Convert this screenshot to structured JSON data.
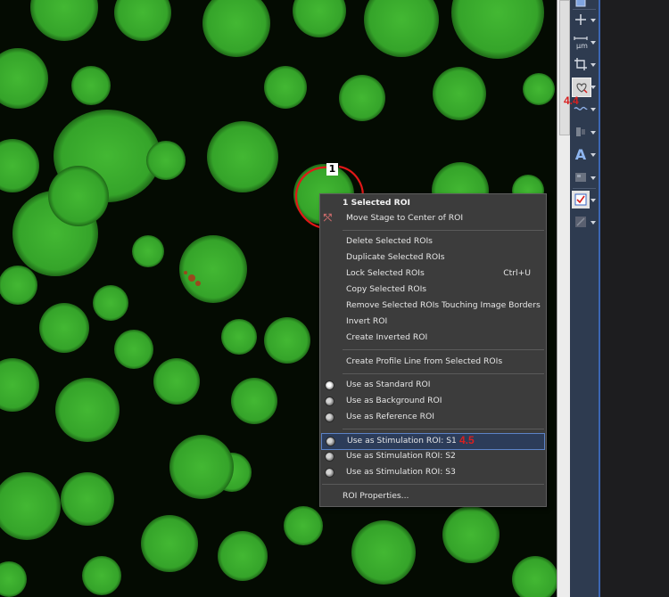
{
  "viewer": {
    "roi_number": "1",
    "colors": {
      "background": "#040b02",
      "cell": "#3db130",
      "roi_outline": "#e01818"
    }
  },
  "toolbar": {
    "buttons": [
      {
        "name": "monitor-icon",
        "glyph": "▭"
      },
      {
        "name": "crosshair-icon",
        "glyph": "+"
      },
      {
        "name": "measure-um-icon",
        "glyph": "μm"
      },
      {
        "name": "crop-icon",
        "glyph": "⌐"
      },
      {
        "name": "heart-roi-icon",
        "glyph": "♡"
      },
      {
        "name": "wave-roi-icon",
        "glyph": "≈"
      },
      {
        "name": "split-icon",
        "glyph": "▮"
      },
      {
        "name": "text-annotation-icon",
        "glyph": "A"
      },
      {
        "name": "image-annotation-icon",
        "glyph": "▦"
      },
      {
        "name": "checked-roi-icon",
        "glyph": "✔"
      },
      {
        "name": "disabled-roi-icon",
        "glyph": "▧"
      }
    ],
    "unit_label": "μm",
    "text_tool_label": "A",
    "colors": {
      "background": "#2e3b50",
      "accent": "#3b66b3"
    }
  },
  "annotations": {
    "step_4_4": "4.4",
    "step_4_5": "4.5",
    "color": "#d82020"
  },
  "context_menu": {
    "header": "1 Selected ROI",
    "move_stage": "Move Stage to Center of ROI",
    "delete": "Delete Selected ROIs",
    "duplicate": "Duplicate Selected ROIs",
    "lock": "Lock Selected ROIs",
    "lock_shortcut": "Ctrl+U",
    "copy": "Copy Selected ROIs",
    "remove_touching": "Remove Selected ROIs Touching Image Borders",
    "invert": "Invert ROI",
    "create_inverted": "Create Inverted ROI",
    "create_profile": "Create Profile Line from Selected ROIs",
    "use_standard": "Use as Standard ROI",
    "use_background": "Use as Background ROI",
    "use_reference": "Use as Reference ROI",
    "use_stim_s1": "Use as Stimulation ROI: S1",
    "use_stim_s2": "Use as Stimulation ROI: S2",
    "use_stim_s3": "Use as Stimulation ROI: S3",
    "properties": "ROI Properties...",
    "colors": {
      "background": "#3c3c3c",
      "highlight": "#2c3c59",
      "text": "#e6e6e6"
    }
  }
}
